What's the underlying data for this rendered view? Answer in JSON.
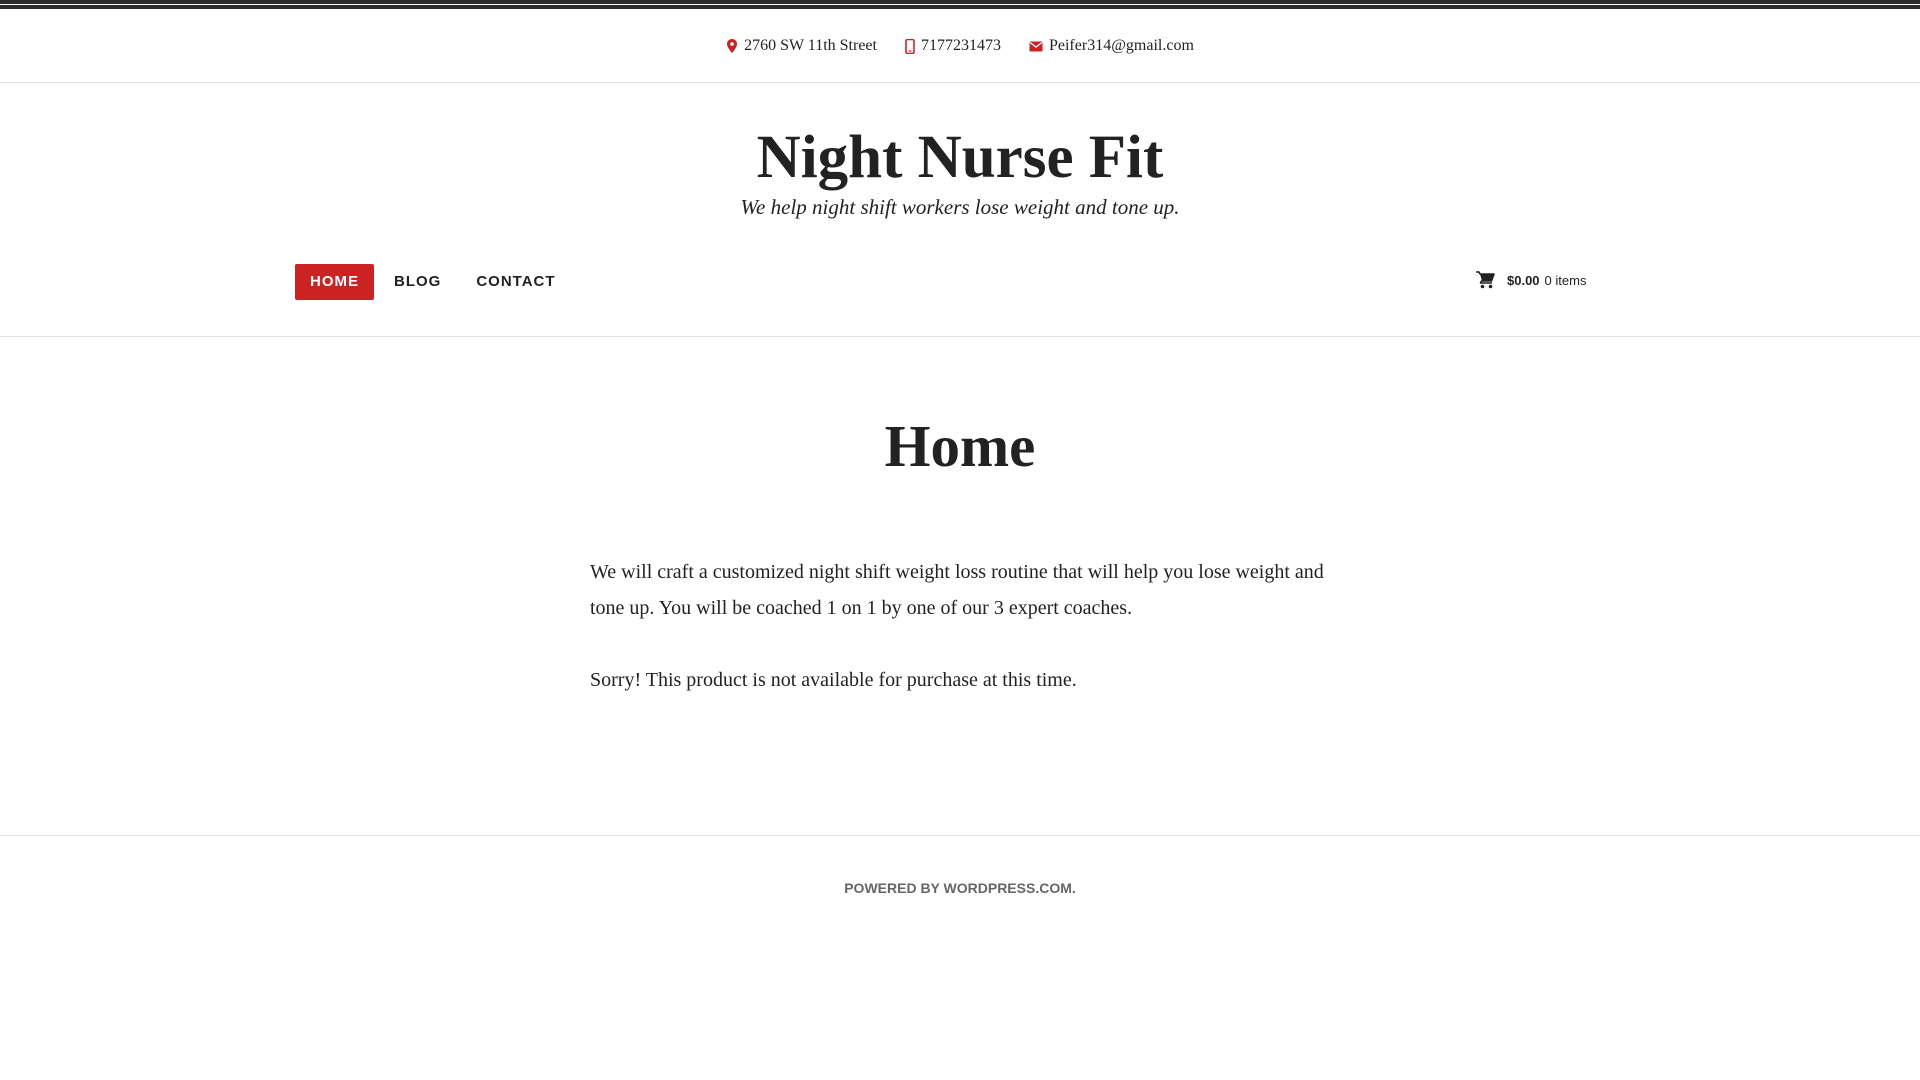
{
  "contact": {
    "address": "2760 SW 11th Street",
    "phone": "7177231473",
    "email": "Peifer314@gmail.com",
    "icons": [
      "location-pin-icon",
      "mobile-phone-icon",
      "envelope-icon"
    ]
  },
  "site": {
    "title": "Night Nurse Fit",
    "tagline": "We help night shift workers lose weight and tone up."
  },
  "nav": {
    "items": [
      {
        "label": "HOME",
        "active": true
      },
      {
        "label": "BLOG",
        "active": false
      },
      {
        "label": "CONTACT",
        "active": false
      }
    ]
  },
  "cart": {
    "icon": "shopping-cart-icon",
    "total": "$0.00",
    "count": "0 items"
  },
  "page": {
    "title": "Home",
    "paragraphs": [
      "We will craft a customized night shift weight loss routine that will help you lose weight and tone up. You will be coached 1 on 1 by one of our 3 expert coaches.",
      "Sorry! This product is not available for purchase at this time."
    ]
  },
  "footer": {
    "prefix": "POWERED BY ",
    "link": "WORDPRESS.COM",
    "suffix": "."
  },
  "colors": {
    "accent": "#cc2322",
    "text": "#222222",
    "footer_text": "#666666",
    "divider": "#e2e2e2"
  }
}
